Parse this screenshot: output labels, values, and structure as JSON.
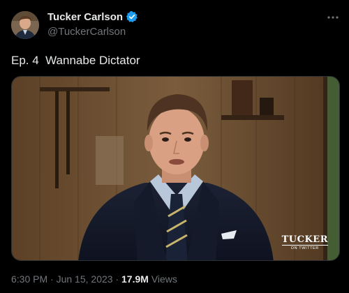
{
  "author": {
    "display_name": "Tucker Carlson",
    "handle": "@TuckerCarlson",
    "verified_icon": "verified-badge-icon",
    "verified_color": "#1d9bf0"
  },
  "tweet": {
    "text": "Ep. 4  Wannabe Dictator"
  },
  "media": {
    "type": "video-thumbnail",
    "watermark_main": "TUCKER",
    "watermark_sub": "ON TWITTER"
  },
  "meta": {
    "time": "6:30 PM",
    "separator": "·",
    "date": "Jun 15, 2023",
    "views_count": "17.9M",
    "views_label": "Views"
  },
  "icons": {
    "more": "more-horizontal-icon"
  },
  "colors": {
    "background": "#000000",
    "text_primary": "#e7e9ea",
    "text_secondary": "#71767b"
  }
}
